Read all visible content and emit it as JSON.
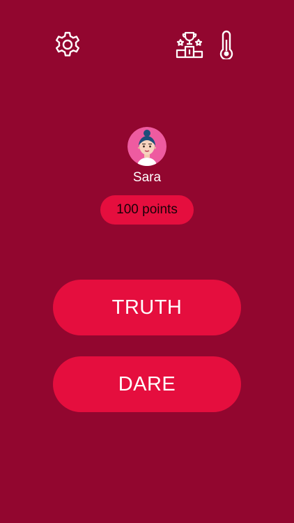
{
  "toolbar": {
    "settings_icon": "gear-icon",
    "leaderboard_icon": "podium-trophy-icon",
    "thermometer_icon": "thermometer-icon"
  },
  "player": {
    "name": "Sara",
    "points": "100 points",
    "avatar_icon": "avatar-woman-icon"
  },
  "actions": {
    "truth_label": "TRUTH",
    "dare_label": "DARE"
  },
  "colors": {
    "background": "#92062F",
    "accent": "#E50E3E",
    "avatar_bg": "#EE5BA0"
  }
}
